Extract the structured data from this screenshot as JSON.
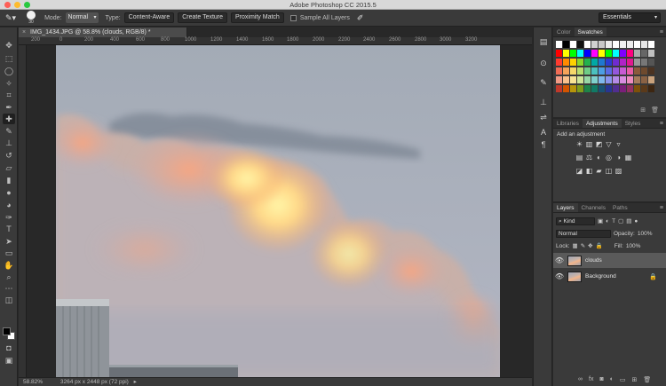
{
  "window": {
    "title": "Adobe Photoshop CC 2015.5",
    "traffic_colors": [
      "#fd5f57",
      "#febb2e",
      "#29c840"
    ]
  },
  "options_bar": {
    "brush_size": "30",
    "mode_label": "Mode:",
    "mode_value": "Normal",
    "type_label": "Type:",
    "type_buttons": [
      "Content-Aware",
      "Create Texture",
      "Proximity Match"
    ],
    "sample_all_layers": "Sample All Layers",
    "workspace": "Essentials"
  },
  "tools": [
    "move-tool",
    "marquee-tool",
    "lasso-tool",
    "quick-select-tool",
    "crop-tool",
    "eyedropper-tool",
    "spot-healing-tool",
    "brush-tool",
    "clone-stamp-tool",
    "history-brush-tool",
    "eraser-tool",
    "gradient-tool",
    "blur-tool",
    "dodge-tool",
    "pen-tool",
    "type-tool",
    "path-select-tool",
    "rectangle-tool",
    "hand-tool",
    "zoom-tool",
    "more-tools"
  ],
  "document": {
    "tab_title": "IMG_1434.JPG @ 58.8% (clouds, RGB/8) *",
    "ruler_marks": [
      "200",
      "0",
      "200",
      "400",
      "600",
      "800",
      "1000",
      "1200",
      "1400",
      "1600",
      "1800",
      "2000",
      "2200",
      "2400",
      "2600",
      "2800",
      "3000",
      "3200"
    ],
    "status_zoom": "58.82%",
    "status_info": "3264 px x 2448 px (72 ppi)"
  },
  "panels": {
    "color_tabs": [
      "Color",
      "Swatches"
    ],
    "swatch_colors": [
      "#ffffff",
      "#000000",
      "#ffffff",
      "#111111",
      "#ffffff",
      "#d0d0d0",
      "#c8c8c8",
      "#ececec",
      "#ffffff",
      "#f0f0f0",
      "#ececec",
      "#ffffff",
      "#e6e6e6",
      "#ffffff",
      "#ff0000",
      "#ffff00",
      "#00ff00",
      "#00ffff",
      "#0000ff",
      "#ff00ff",
      "#ffff00",
      "#00ff00",
      "#00ffff",
      "#8000ff",
      "#ff0080",
      "#aaaaaa",
      "#666666",
      "#c0c0c0",
      "#ff3b2f",
      "#ff8a00",
      "#ffd200",
      "#8bd62b",
      "#23b14d",
      "#00a9a5",
      "#1f77d0",
      "#2b3bd1",
      "#6f2bd1",
      "#b123c7",
      "#e0198f",
      "#999999",
      "#777777",
      "#555555",
      "#f06c55",
      "#f5a35a",
      "#f6d86a",
      "#b8de6e",
      "#6fcc86",
      "#4bc1bf",
      "#4c9ee3",
      "#5a6be4",
      "#9457dc",
      "#c85bd3",
      "#ea5ca8",
      "#8b5a3c",
      "#6e4a2e",
      "#4b3322",
      "#f29b86",
      "#f8c08c",
      "#f8e395",
      "#cfe698",
      "#97d8a6",
      "#7fd0cd",
      "#7fb8ec",
      "#8a94ee",
      "#b48ae6",
      "#d98ce0",
      "#ef8cc1",
      "#a67b5b",
      "#8a6244",
      "#c9a27c",
      "#c0392b",
      "#d35400",
      "#b7950b",
      "#7d9c1b",
      "#1e8449",
      "#117a65",
      "#1a5276",
      "#283593",
      "#512e91",
      "#7b1f7a",
      "#943160",
      "#7e5109",
      "#5b3a1a",
      "#3d2611"
    ],
    "adjust_tabs": [
      "Libraries",
      "Adjustments",
      "Styles"
    ],
    "adjust_title": "Add an adjustment",
    "adjust_row1": [
      "☀",
      "▥",
      "◩",
      "▽",
      "▿"
    ],
    "adjust_row2": [
      "▤",
      "⚖",
      "◐",
      "◎",
      "◑",
      "▦"
    ],
    "adjust_row3": [
      "◪",
      "◧",
      "▰",
      "◫",
      "▨"
    ],
    "layer_tabs": [
      "Layers",
      "Channels",
      "Paths"
    ],
    "layer_filter": "Kind",
    "blend_mode": "Normal",
    "opacity_label": "Opacity:",
    "opacity_value": "100%",
    "lock_label": "Lock:",
    "fill_label": "Fill:",
    "fill_value": "100%",
    "layers": [
      {
        "name": "clouds",
        "selected": true
      },
      {
        "name": "Background",
        "selected": false
      }
    ]
  }
}
